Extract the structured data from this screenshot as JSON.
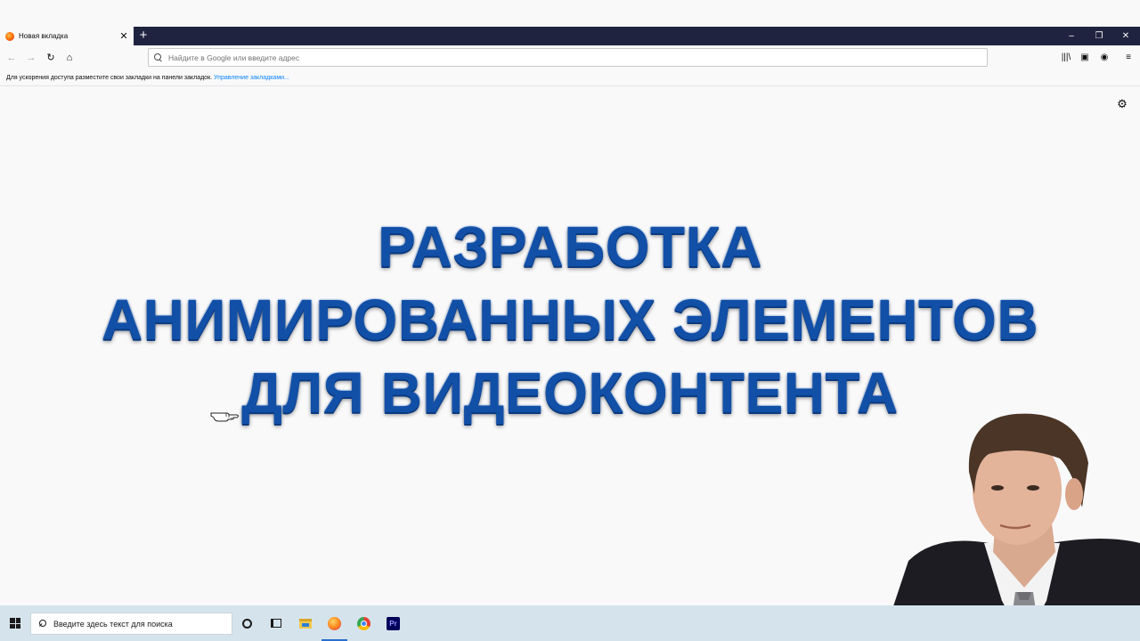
{
  "browser": {
    "tab_title": "Новая вкладка",
    "tab_close": "✕",
    "new_tab": "+",
    "window_controls": {
      "minimize": "–",
      "restore": "❐",
      "close": "✕"
    },
    "nav": {
      "back": "←",
      "forward": "→",
      "reload": "↻",
      "home": "⌂"
    },
    "url_placeholder": "Найдите в Google или введите адрес",
    "url_value": "",
    "toolbar_right": {
      "library": "|||\\",
      "sidebar": "▣",
      "account": "◉",
      "menu": "≡"
    }
  },
  "bookmarks_bar": {
    "hint_text": "Для ускорения доступа разместите свои закладки на панели закладок.",
    "manage_link": "Управление закладками..."
  },
  "page": {
    "settings_gear": "⚙",
    "headline": [
      "РАЗРАБОТКА",
      "АНИМИРОВАННЫХ ЭЛЕМЕНТОВ",
      "ДЛЯ ВИДЕОКОНТЕНТА"
    ]
  },
  "taskbar": {
    "search_placeholder": "Введите здесь текст для поиска",
    "pinned_apps": [
      "cortana",
      "task-view",
      "file-explorer",
      "firefox",
      "chrome",
      "premiere-pro"
    ],
    "active_app": "firefox",
    "premiere_label": "Pr"
  },
  "colors": {
    "tabstrip": "#202340",
    "headline": "#1250a8",
    "taskbar": "#d5e4ec",
    "link": "#0a84ff"
  }
}
